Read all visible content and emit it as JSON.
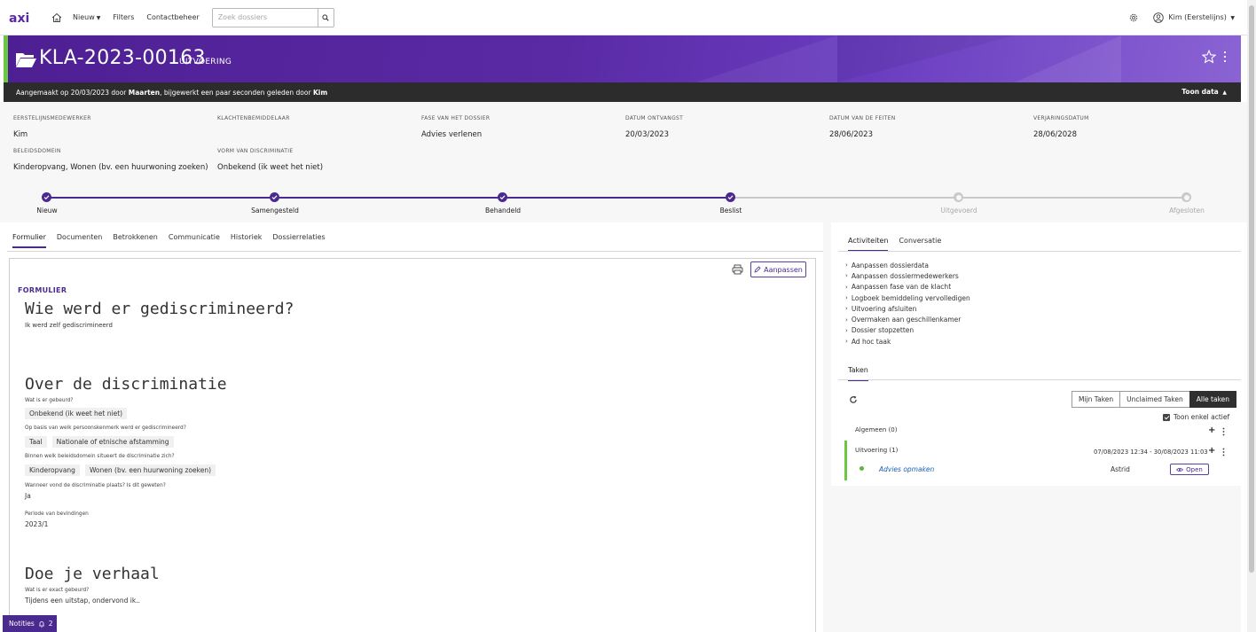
{
  "nav": {
    "logo": "axi",
    "items": [
      {
        "label": "Nieuw",
        "has_caret": true
      },
      {
        "label": "Filters",
        "has_caret": false
      },
      {
        "label": "Contactbeheer",
        "has_caret": false
      }
    ],
    "search_placeholder": "Zoek dossiers",
    "user": "Kim (Eerstelijns)"
  },
  "header": {
    "dossier_id": "KLA-2023-00163",
    "status": "UITVOERING",
    "created_prefix": "Aangemaakt op 20/03/2023 door ",
    "created_by": "Maarten",
    "updated_text": ", bijgewerkt een paar seconden geleden door ",
    "updated_by": "Kim",
    "toon_data": "Toon data"
  },
  "fields": [
    {
      "label": "EERSTELIJNSMEDEWERKER",
      "value": "Kim"
    },
    {
      "label": "KLACHTENBEMIDDELAAR",
      "value": ""
    },
    {
      "label": "FASE VAN HET DOSSIER",
      "value": "Advies verlenen"
    },
    {
      "label": "DATUM ONTVANGST",
      "value": "20/03/2023"
    },
    {
      "label": "DATUM VAN DE FEITEN",
      "value": "28/06/2023"
    },
    {
      "label": "VERJARINGSDATUM",
      "value": "28/06/2028"
    },
    {
      "label": "BELEIDSDOMEIN",
      "value": "Kinderopvang, Wonen (bv. een huurwoning zoeken)"
    },
    {
      "label": "VORM VAN DISCRIMINATIE",
      "value": "Onbekend (ik weet het niet)"
    }
  ],
  "steps": [
    {
      "label": "Nieuw",
      "done": true
    },
    {
      "label": "Samengesteld",
      "done": true
    },
    {
      "label": "Behandeld",
      "done": true
    },
    {
      "label": "Beslist",
      "done": true
    },
    {
      "label": "Uitgevoerd",
      "done": false
    },
    {
      "label": "Afgesloten",
      "done": false
    }
  ],
  "left_tabs": [
    "Formulier",
    "Documenten",
    "Betrokkenen",
    "Communicatie",
    "Historiek",
    "Dossierrelaties"
  ],
  "form": {
    "aanpassen": "Aanpassen",
    "section_label": "FORMULIER",
    "q1_title": "Wie werd er gediscrimineerd?",
    "q1_answer": "Ik werd zelf gediscrimineerd",
    "s2_title": "Over de discriminatie",
    "wat_label": "Wat is er gebeurd?",
    "wat_chips": [
      "Onbekend (ik weet het niet)"
    ],
    "kenmerk_label": "Op basis van welk persoonskenmerk werd er gediscrimineerd?",
    "kenmerk_chips": [
      "Taal",
      "Nationale of etnische afstamming"
    ],
    "domein_label": "Binnen welk beleidsdomein situeert de discriminatie zich?",
    "domein_chips": [
      "Kinderopvang",
      "Wonen (bv. een huurwoning zoeken)"
    ],
    "wanneer_label": "Wanneer vond de discriminatie plaats? Is dit geweten?",
    "wanneer_value": "Ja",
    "periode_label": "Periode van bevindingen",
    "periode_value": "2023/1",
    "s3_title": "Doe je verhaal",
    "exact_label": "Wat is er exact gebeurd?",
    "exact_value": "Tijdens een uitstap, ondervond ik.."
  },
  "notities": {
    "label": "Notities",
    "count": "2"
  },
  "right": {
    "tabs": [
      "Activiteiten",
      "Conversatie"
    ],
    "activities": [
      "Aanpassen dossierdata",
      "Aanpassen dossiermedewerkers",
      "Aanpassen fase van de klacht",
      "Logboek bemiddeling vervolledigen",
      "Uitvoering afsluiten",
      "Overmaken aan geschillenkamer",
      "Dossier stopzetten",
      "Ad hoc taak"
    ],
    "taken_tab": "Taken",
    "task_filters": [
      "Mijn Taken",
      "Unclaimed Taken",
      "Alle taken"
    ],
    "toon_actief": "Toon enkel actief",
    "group_algemeen": "Algemeen (0)",
    "group_uitvoering": "Uitvoering (1)",
    "task": {
      "date_range": "07/08/2023 12:34 - 30/08/2023 11:03",
      "name": "Advies opmaken",
      "assignee": "Astrid",
      "open": "Open"
    }
  },
  "colors": {
    "brand": "#4b2a8f",
    "accent_green": "#6ac73f"
  }
}
